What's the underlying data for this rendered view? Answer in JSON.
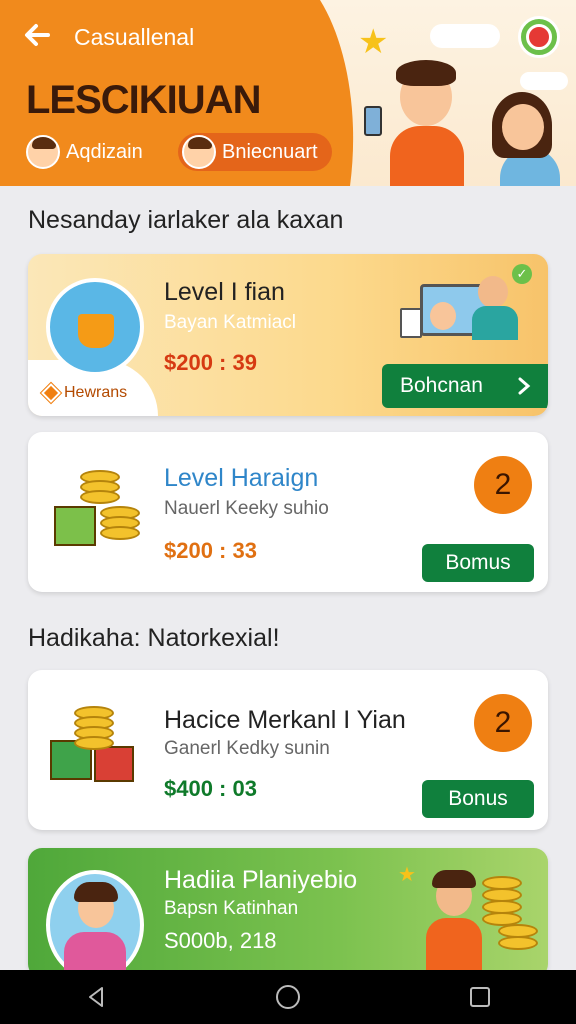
{
  "header": {
    "back_icon": "arrow-left-icon",
    "app_title": "Casuallenal",
    "page_title": "LESCIKIUAN",
    "chips": [
      {
        "label": "Aqdizain"
      },
      {
        "label": "Bniecnuart"
      }
    ]
  },
  "sections": [
    {
      "heading": "Nesanday iarlaker ala kaxan"
    },
    {
      "heading": "Hadikaha:  Natorkexial!"
    }
  ],
  "cards": [
    {
      "title": "Level I fian",
      "subtitle": "Bayan Katmiacl",
      "price": "$200 : 39",
      "button_label": "Bohcnan",
      "tag": "Hewrans"
    },
    {
      "title": "Level Haraign",
      "subtitle": "Nauerl Keeky suhio",
      "price": "$200 : 33",
      "badge": "2",
      "button_label": "Bomus"
    },
    {
      "title": "Hacice Merkanl I Yian",
      "subtitle": "Ganerl Kedky sunin",
      "price": "$400 : 03",
      "badge": "2",
      "button_label": "Bonus"
    },
    {
      "title": "Hadiia Planiyebio",
      "subtitle": "Bapsn Katinhan",
      "price": "S000b, 218"
    }
  ],
  "colors": {
    "header_orange": "#f18a1c",
    "button_green": "#10803d",
    "price_red": "#d63a12",
    "price_orange": "#e07012",
    "price_green": "#0f7a2a",
    "title_blue": "#2f86c9",
    "badge_orange": "#ef7f12"
  }
}
